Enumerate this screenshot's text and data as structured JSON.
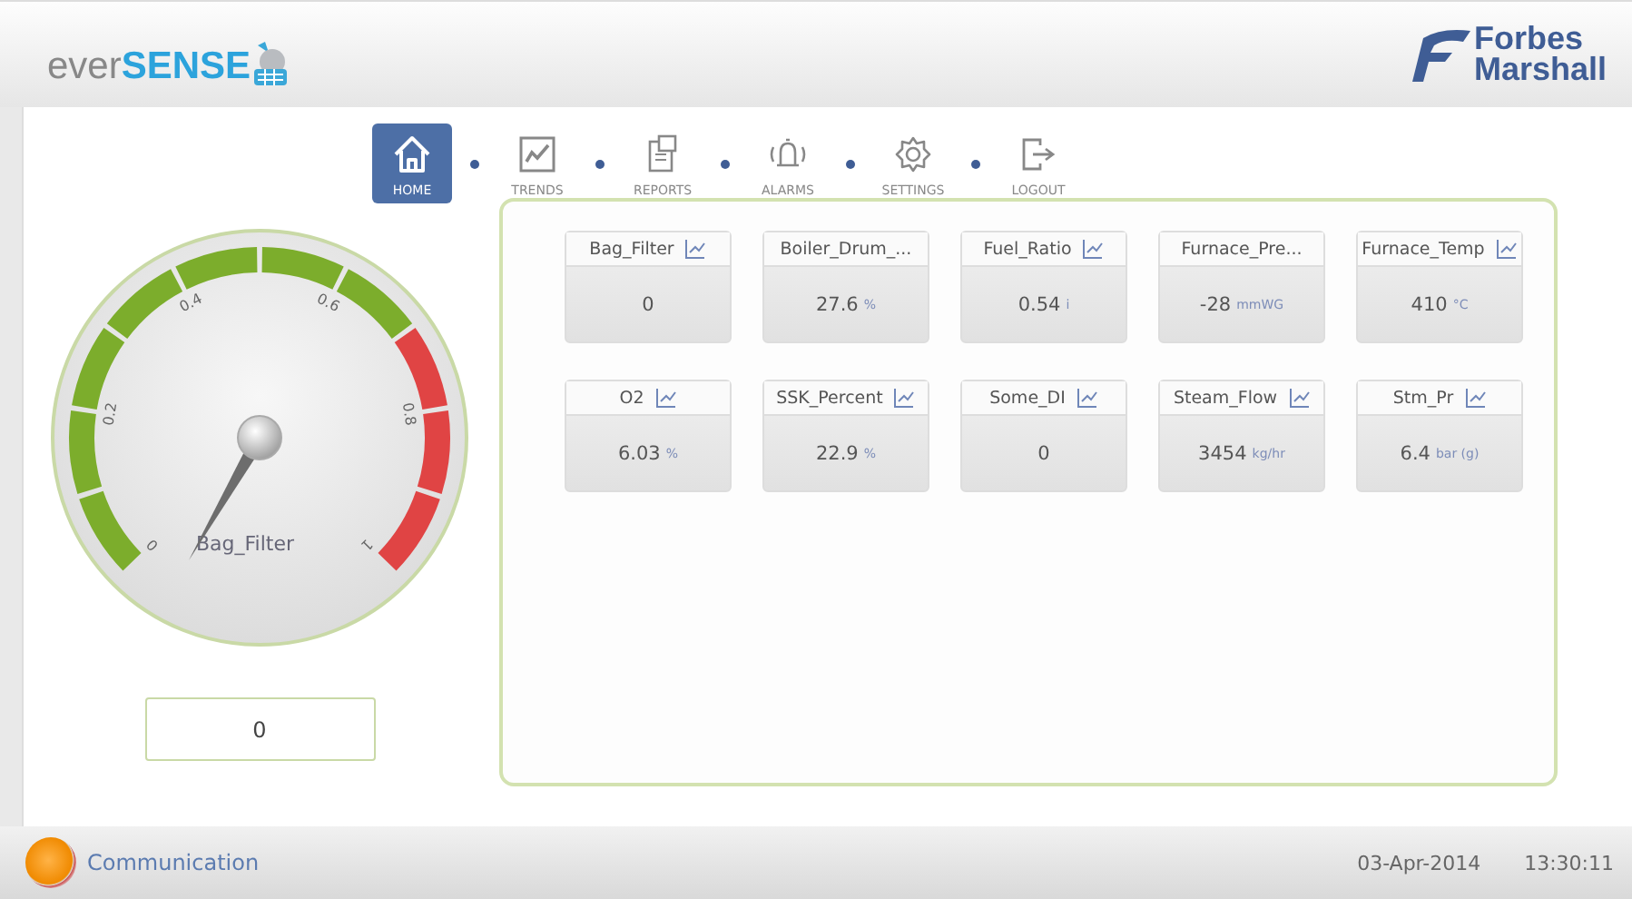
{
  "header": {
    "logo": {
      "prefix": "ever",
      "main": "SENSE"
    },
    "brand_lines": [
      "Forbes",
      "Marshall"
    ]
  },
  "nav": [
    {
      "label": "HOME",
      "selected": true
    },
    {
      "label": "TRENDS",
      "selected": false
    },
    {
      "label": "REPORTS",
      "selected": false
    },
    {
      "label": "ALARMS",
      "selected": false
    },
    {
      "label": "SETTINGS",
      "selected": false
    },
    {
      "label": "LOGOUT",
      "selected": false
    }
  ],
  "gauge": {
    "title": "Bag_Filter",
    "tick_labels": [
      "0",
      "0.2",
      "0.4",
      "0.6",
      "0.8",
      "1"
    ],
    "value": "0"
  },
  "tiles": [
    {
      "name": "Bag_Filter",
      "value": "0",
      "chart_icon": true
    },
    {
      "name": "Boiler_Drum_...",
      "value": "27.6",
      "unit": "%",
      "chart_icon": false
    },
    {
      "name": "Fuel_Ratio",
      "value": "0.54",
      "unit": "i",
      "chart_icon": true
    },
    {
      "name": "Furnace_Pre...",
      "value": "-28",
      "unit": "mmWG",
      "chart_icon": false
    },
    {
      "name": "Furnace_Temp",
      "value": "410",
      "unit": "°C",
      "chart_icon": true
    },
    {
      "name": "O2",
      "value": "6.03",
      "unit": "%",
      "chart_icon": true
    },
    {
      "name": "SSK_Percent",
      "value": "22.9",
      "unit": "%",
      "chart_icon": true
    },
    {
      "name": "Some_DI",
      "value": "0",
      "chart_icon": true
    },
    {
      "name": "Steam_Flow",
      "value": "3454",
      "unit": "kg/hr",
      "chart_icon": true
    },
    {
      "name": "Stm_Pr",
      "value": "6.4",
      "unit": "bar (g)",
      "chart_icon": true
    }
  ],
  "status_bar": {
    "label": "Communication",
    "date": "03-Apr-2014",
    "time": "13:30:11"
  }
}
